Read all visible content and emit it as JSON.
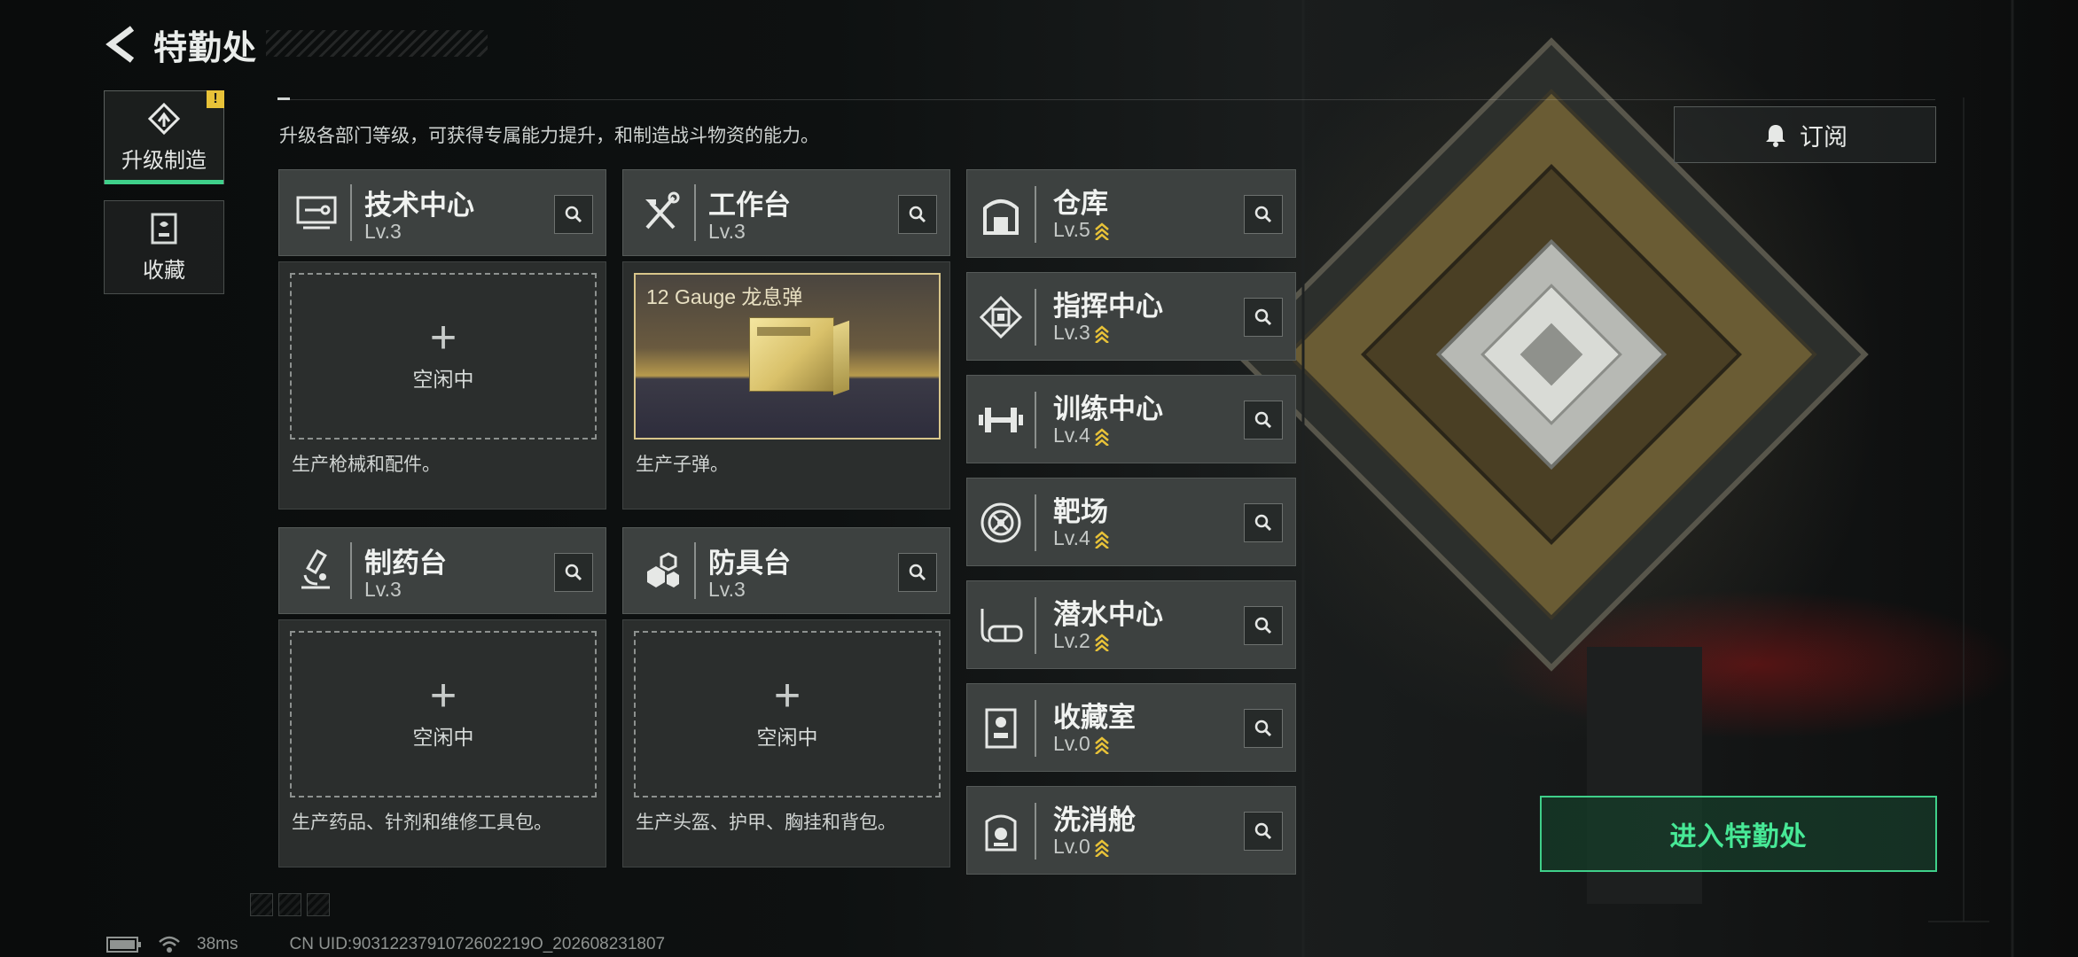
{
  "header": {
    "title": "特勤处"
  },
  "nav": [
    {
      "label": "升级制造",
      "active": true,
      "badge": "!"
    },
    {
      "label": "收藏",
      "active": false
    }
  ],
  "description": "升级各部门等级，可获得专属能力提升，和制造战斗物资的能力。",
  "subscribe": {
    "label": "订阅"
  },
  "production_facilities": [
    {
      "name": "技术中心",
      "level": "Lv.3",
      "slot_status": "空闲中",
      "desc": "生产枪械和配件。"
    },
    {
      "name": "工作台",
      "level": "Lv.3",
      "product_name": "12 Gauge 龙息弹",
      "desc": "生产子弹。"
    },
    {
      "name": "制药台",
      "level": "Lv.3",
      "slot_status": "空闲中",
      "desc": "生产药品、针剂和维修工具包。"
    },
    {
      "name": "防具台",
      "level": "Lv.3",
      "slot_status": "空闲中",
      "desc": "生产头盔、护甲、胸挂和背包。"
    }
  ],
  "facilities": [
    {
      "name": "仓库",
      "level": "Lv.5"
    },
    {
      "name": "指挥中心",
      "level": "Lv.3"
    },
    {
      "name": "训练中心",
      "level": "Lv.4"
    },
    {
      "name": "靶场",
      "level": "Lv.4"
    },
    {
      "name": "潜水中心",
      "level": "Lv.2"
    },
    {
      "name": "收藏室",
      "level": "Lv.0"
    },
    {
      "name": "洗消舱",
      "level": "Lv.0"
    }
  ],
  "enter_button": {
    "label": "进入特勤处"
  },
  "footer": {
    "ping": "38ms",
    "uid": "CN UID:9031223791072602219O_202608231807"
  },
  "colors": {
    "accent": "#3fd08a",
    "upgrade_chevron": "#e8c238",
    "badge": "#e8c238"
  }
}
